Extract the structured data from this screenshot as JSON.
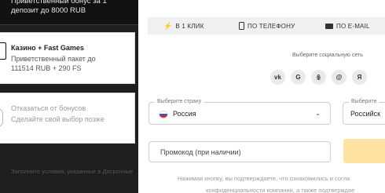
{
  "left": {
    "top_bonus_text_1": "Приветственный бонус за 1",
    "top_bonus_text_2": "депозит до 8000 RUB",
    "card1_title": "Казино + Fast Games",
    "card1_desc_1": "Приветственный пакет до",
    "card1_desc_2": "111514 RUB + 290 FS",
    "card2_title": "Отказаться от бонусов",
    "card2_desc": "Сделайте свой выбор позже",
    "footer_text": "Заполните условия, указанные в Досрочные"
  },
  "tabs": [
    {
      "label": "В 1 КЛИК",
      "icon": "bolt-icon"
    },
    {
      "label": "ПО ТЕЛЕФОНУ",
      "icon": "phone-icon"
    },
    {
      "label": "ПО E-MAIL",
      "icon": "mail-icon"
    }
  ],
  "social": {
    "title": "Выберите социальную сеть",
    "items": [
      "vk",
      "G",
      "ok",
      "@",
      "Я"
    ]
  },
  "country": {
    "label": "Выберите страну",
    "value": "Россия"
  },
  "currency": {
    "label": "Выберите",
    "value": "Российск"
  },
  "promo": {
    "placeholder": "Промокод (при наличии)"
  },
  "disclaimer": {
    "line1": "Нажимая кнопку, вы подтверждаете, что ознакомились и согла",
    "line2": "конфиденциальности компании, а также подтверждае"
  },
  "colors": {
    "accent": "#ffe3a3",
    "panel": "#ffffff",
    "dark": "#1e1e1e"
  }
}
